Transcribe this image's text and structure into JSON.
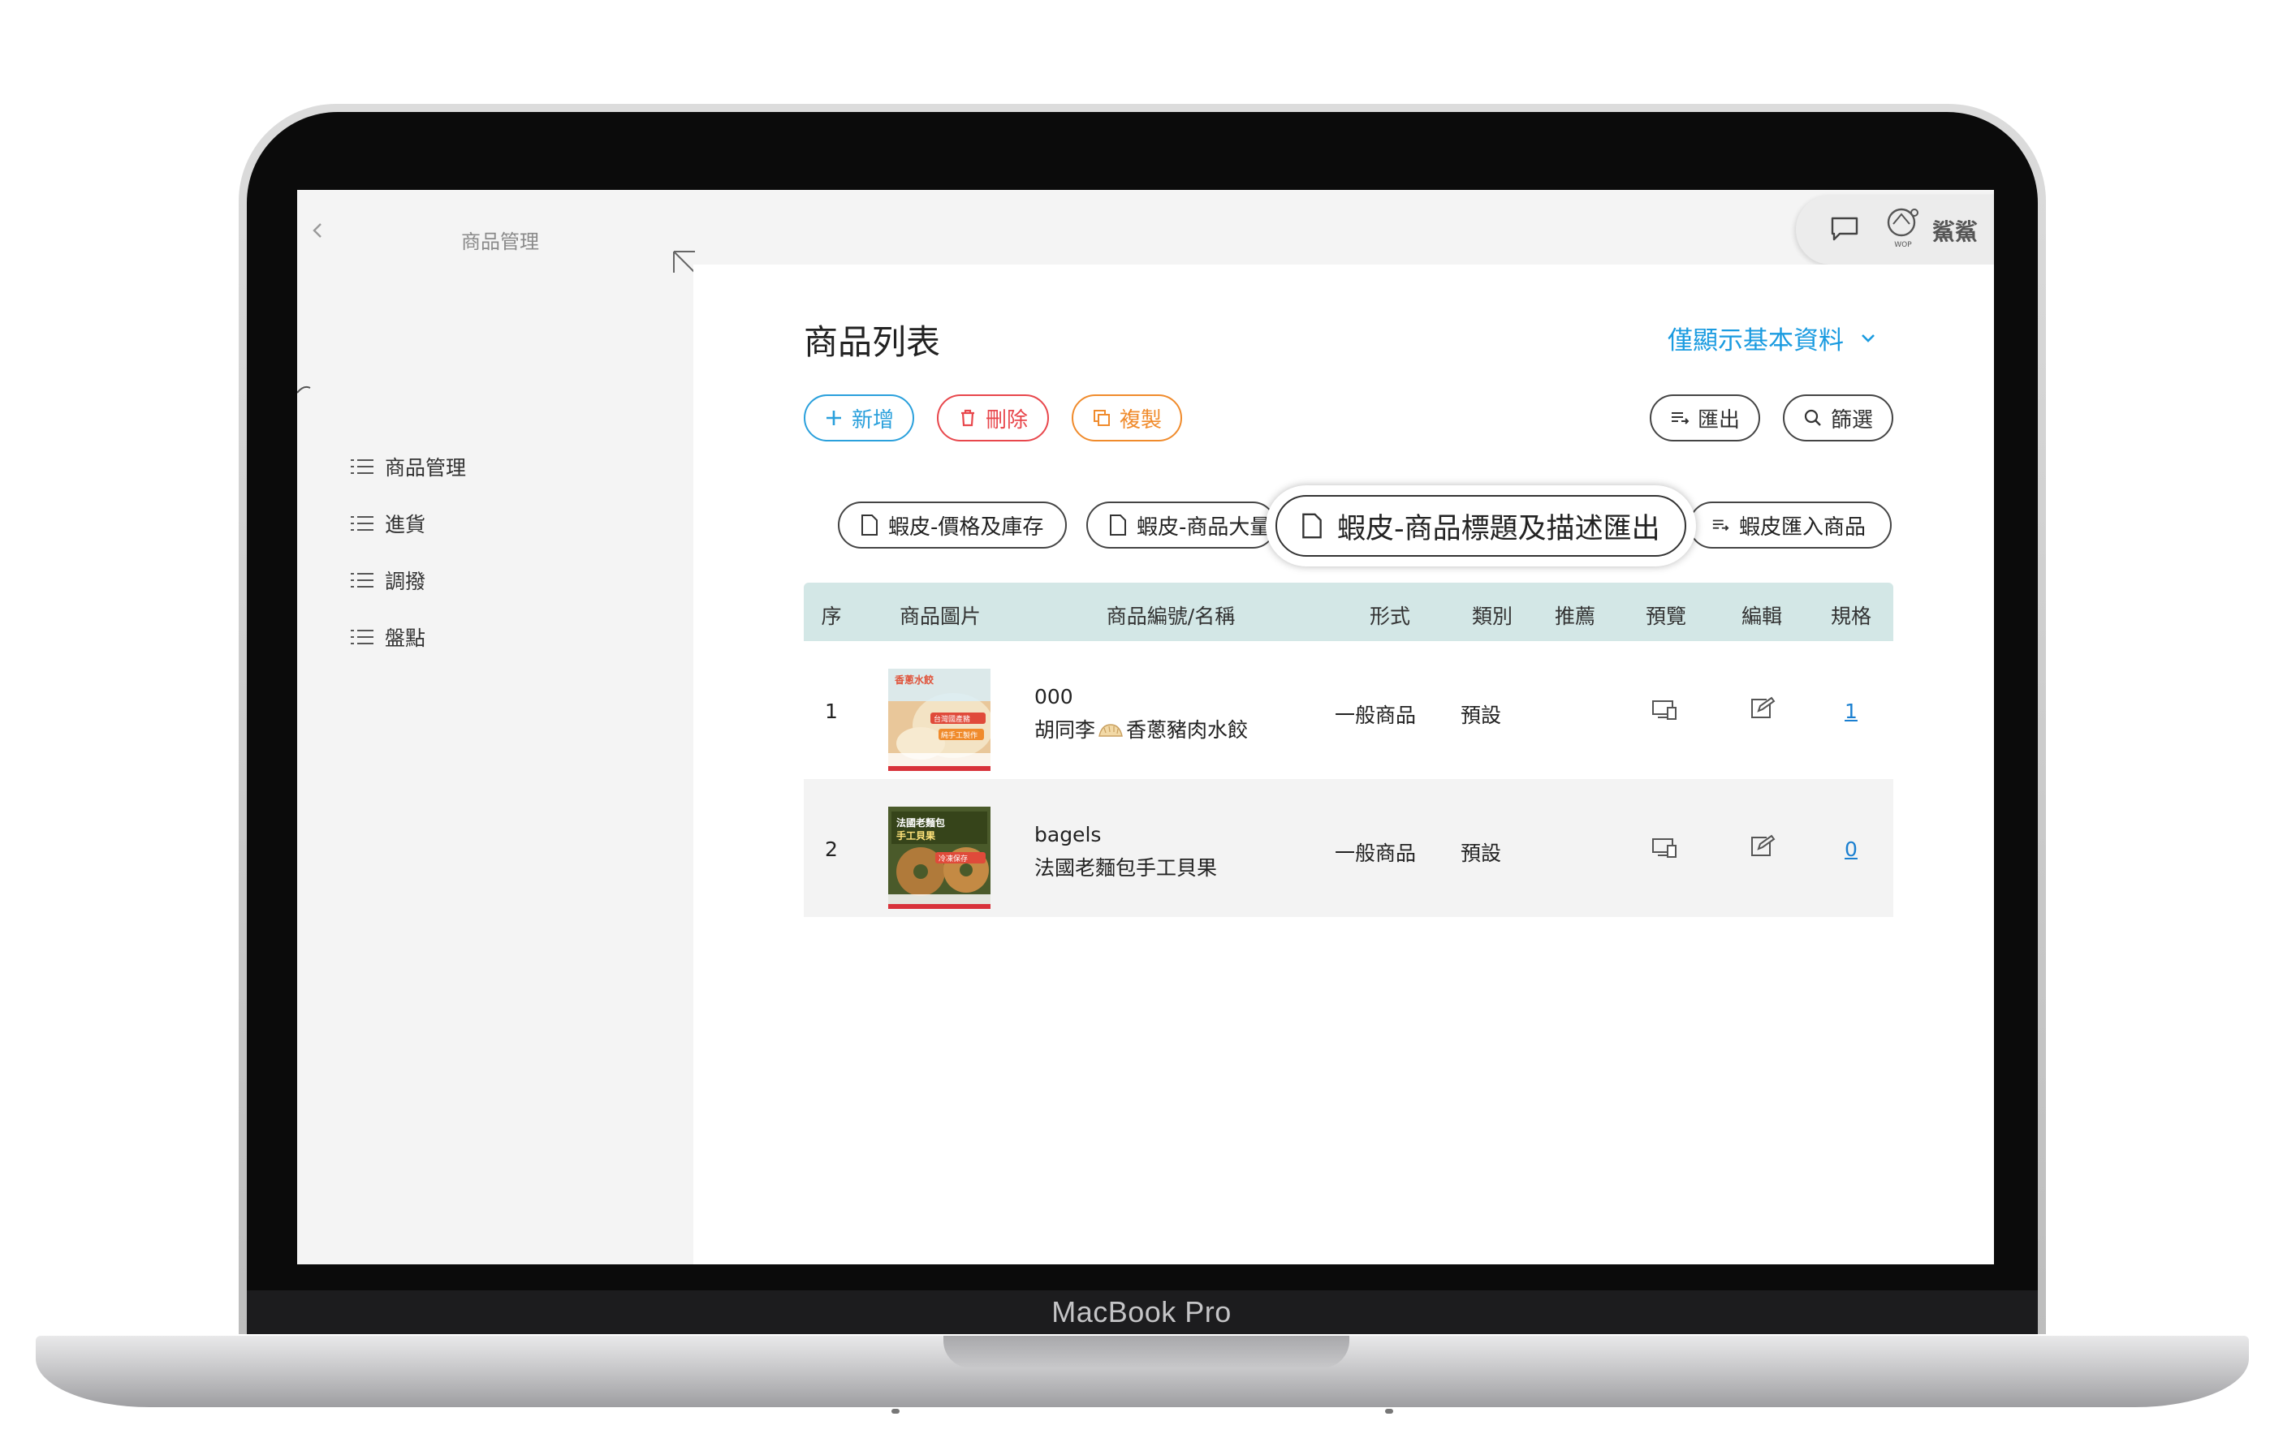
{
  "device": {
    "brand_label": "MacBook Pro"
  },
  "sidebar": {
    "title": "商品管理",
    "items": [
      {
        "label": "商品管理"
      },
      {
        "label": "進貨"
      },
      {
        "label": "調撥"
      },
      {
        "label": "盤點"
      }
    ]
  },
  "topbar": {
    "logo_text": "WOP",
    "user_name": "鯊鯊"
  },
  "main": {
    "page_title": "商品列表",
    "view_toggle": "僅顯示基本資料",
    "toolbar": {
      "add": "新增",
      "delete": "刪除",
      "copy": "複製",
      "export": "匯出",
      "filter": "篩選"
    },
    "chips": {
      "price_stock": "蝦皮-價格及庫存",
      "bulk": "蝦皮-商品大量",
      "title_desc": "蝦皮-商品標題及描述匯出",
      "import": "蝦皮匯入商品"
    },
    "table": {
      "columns": [
        "序",
        "商品圖片",
        "商品編號/名稱",
        "形式",
        "類別",
        "推薦",
        "預覽",
        "編輯",
        "規格"
      ],
      "rows": [
        {
          "index": "1",
          "code": "000",
          "name": "胡同李",
          "name_suffix": "香蔥豬肉水餃",
          "type": "一般商品",
          "category": "預設",
          "recommend": "",
          "spec": "1",
          "thumb": {
            "headline": "香蔥水餃",
            "sub": "台灣國產豬",
            "tag": "純手工製作"
          }
        },
        {
          "index": "2",
          "code": "bagels",
          "name": "法國老麵包手工貝果",
          "type": "一般商品",
          "category": "預設",
          "recommend": "",
          "spec": "0",
          "thumb": {
            "headline": "法國老麵包",
            "sub": "手工貝果",
            "tag": "冷凍保存"
          }
        }
      ]
    }
  },
  "colors": {
    "accent_blue": "#1a9be0",
    "danger_red": "#e8474c",
    "warning_orange": "#f08b2c",
    "table_header": "#d3e7e6",
    "link_blue": "#1a7fd0"
  }
}
